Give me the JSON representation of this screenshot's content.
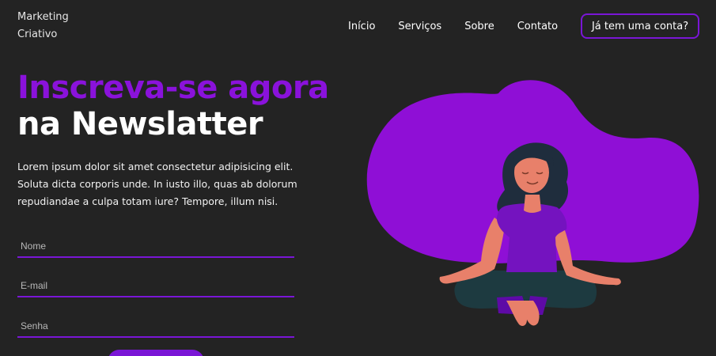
{
  "brand": {
    "line1": "Marketing",
    "line2": "Criativo"
  },
  "nav": {
    "items": [
      {
        "label": "Início"
      },
      {
        "label": "Serviços"
      },
      {
        "label": "Sobre"
      },
      {
        "label": "Contato"
      }
    ],
    "login_label": "Já tem uma conta?"
  },
  "hero": {
    "title_accent": "Inscreva-se agora",
    "title_rest": "na Newslatter",
    "description": "Lorem ipsum dolor sit amet consectetur adipisicing elit. Soluta dicta corporis unde. In iusto illo, quas ab dolorum repudiandae a culpa totam iure? Tempore, illum nisi."
  },
  "form": {
    "name_placeholder": "Nome",
    "email_placeholder": "E-mail",
    "password_placeholder": "Senha"
  },
  "colors": {
    "accent": "#8a12db",
    "background": "#232323",
    "skin": "#e8806a",
    "hair": "#1f2d3d",
    "pants": "#1d3a40"
  },
  "illustration": {
    "icon": "meditating-woman-illustration"
  }
}
